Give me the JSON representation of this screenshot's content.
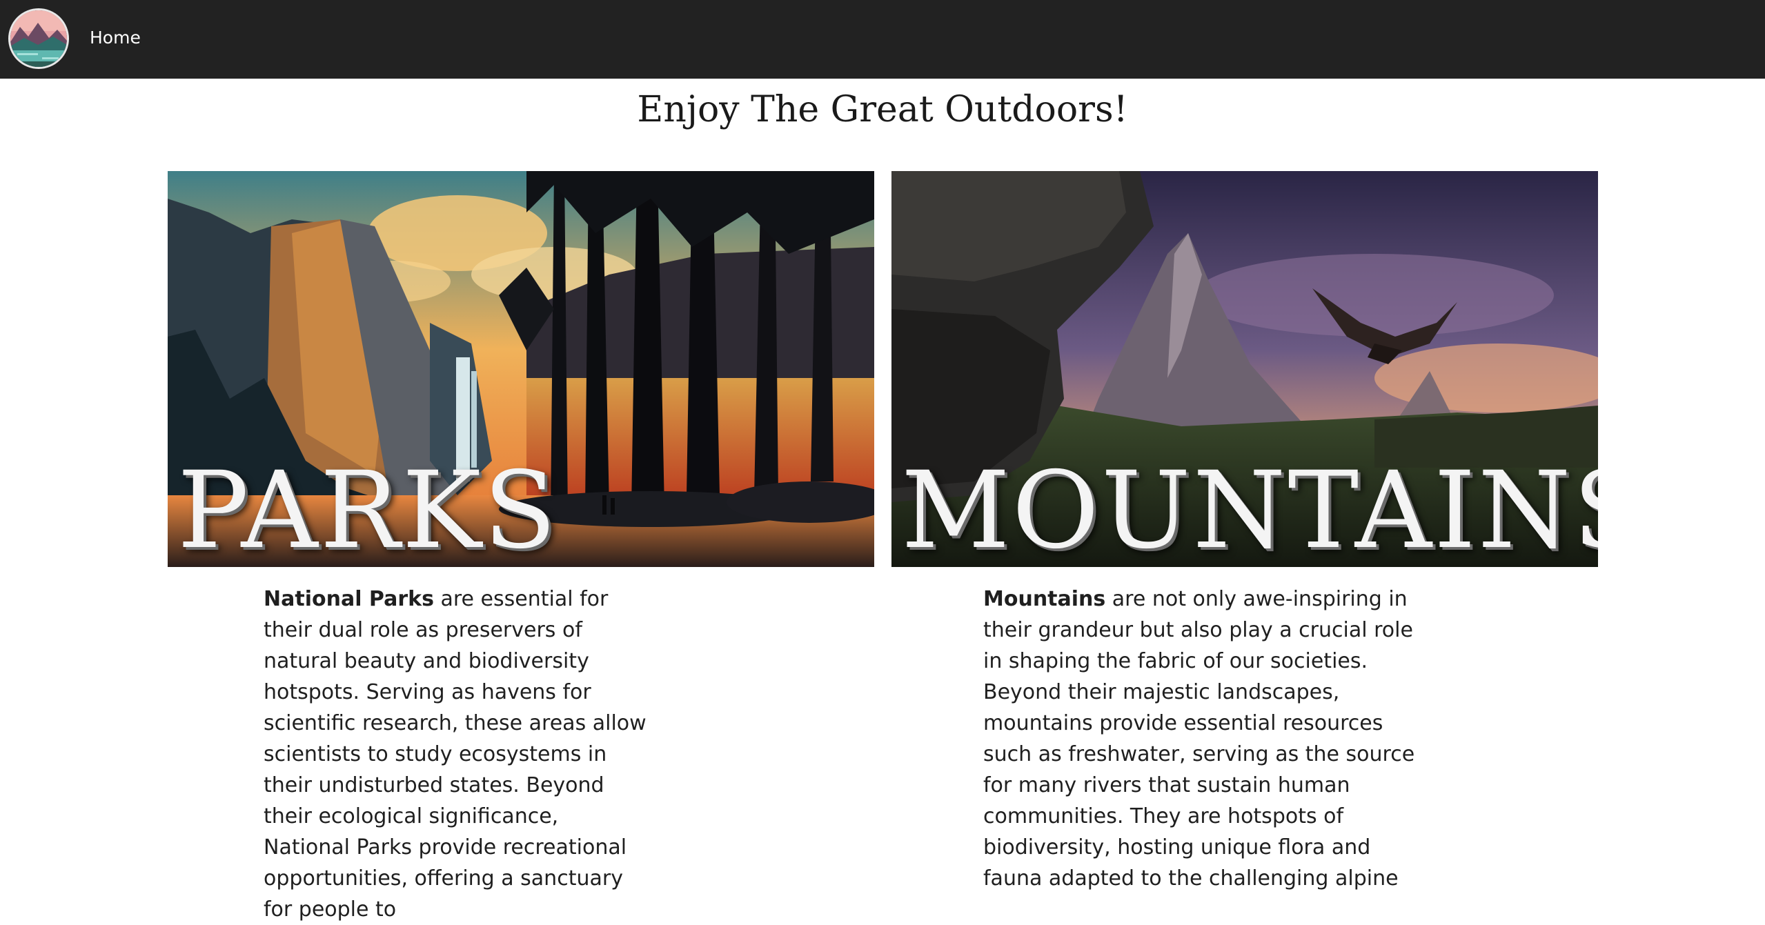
{
  "navbar": {
    "home_label": "Home"
  },
  "logo": {
    "icon": "mountain-lake-logo-icon"
  },
  "page": {
    "title": "Enjoy The Great Outdoors!"
  },
  "cards": [
    {
      "overlay_title": "PARKS",
      "lead": "National Parks",
      "body": " are essential for their dual role as preservers of natural beauty and biodiversity hotspots. Serving as havens for scientific research, these areas allow scientists to study ecosystems in their undisturbed states. Beyond their ecological significance, National Parks provide recreational opportunities, offering a sanctuary for people to"
    },
    {
      "overlay_title": "MOUNTAINS",
      "lead": "Mountains",
      "body": " are not only awe-inspiring in their grandeur but also play a crucial role in shaping the fabric of our societies. Beyond their majestic landscapes, mountains provide essential resources such as freshwater, serving as the source for many rivers that sustain human communities. They are hotspots of biodiversity, hosting unique flora and fauna adapted to the challenging alpine"
    }
  ],
  "colors": {
    "navbar_bg": "#222222",
    "page_bg": "#ffffff",
    "text": "#1f1f1f"
  }
}
